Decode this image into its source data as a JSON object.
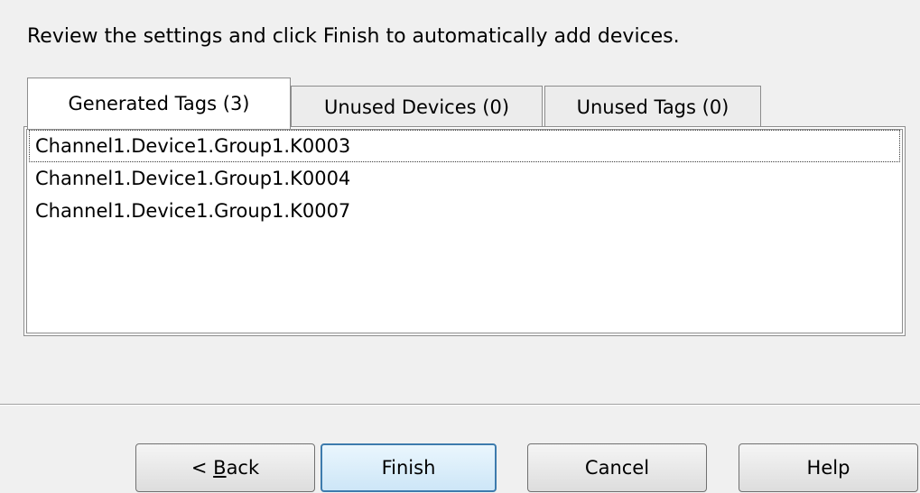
{
  "instruction": "Review the settings and click Finish to automatically add devices.",
  "tabs": [
    {
      "label": "Generated Tags (3)",
      "active": true
    },
    {
      "label": "Unused Devices (0)",
      "active": false
    },
    {
      "label": "Unused Tags (0)",
      "active": false
    }
  ],
  "generated_tags": [
    "Channel1.Device1.Group1.K0003",
    "Channel1.Device1.Group1.K0004",
    "Channel1.Device1.Group1.K0007"
  ],
  "buttons": {
    "back_prefix": "< ",
    "back_mnemonic": "B",
    "back_rest": "ack",
    "finish": "Finish",
    "cancel": "Cancel",
    "help": "Help"
  }
}
